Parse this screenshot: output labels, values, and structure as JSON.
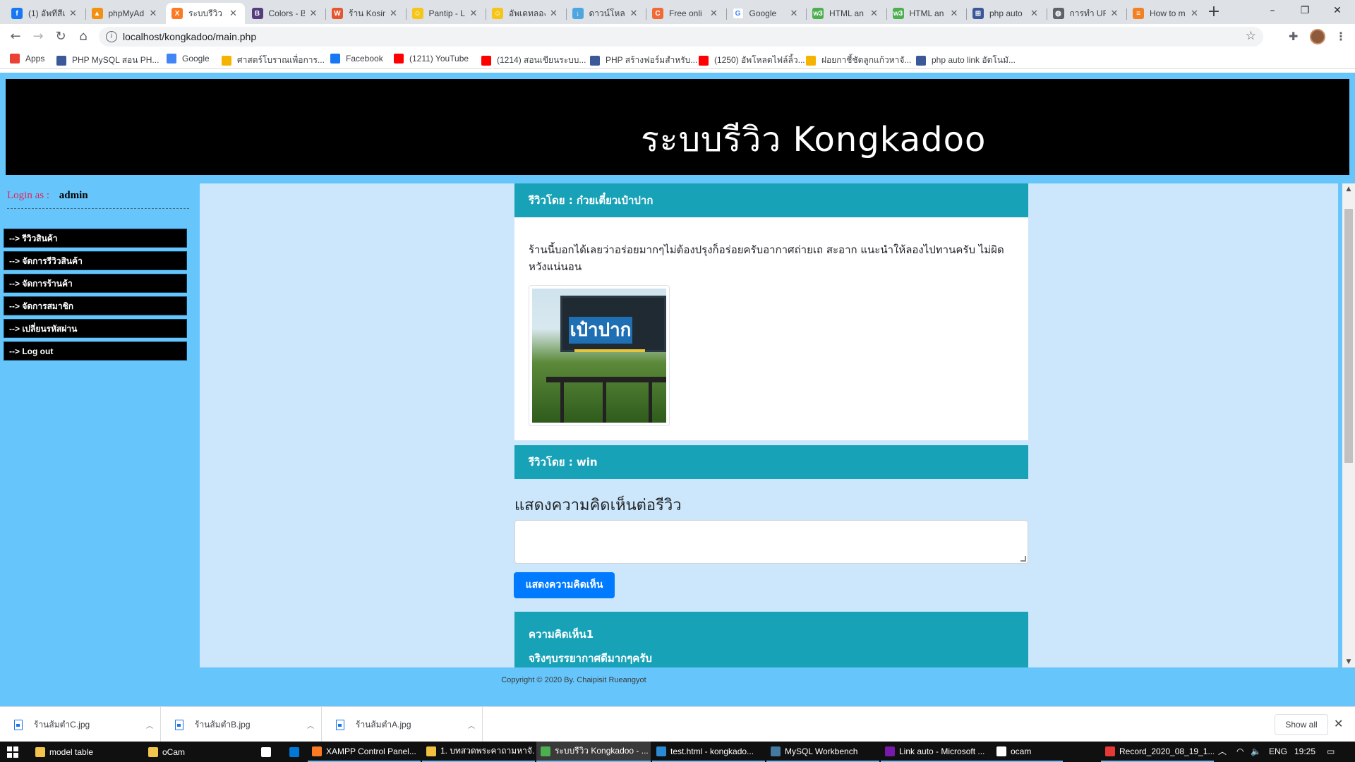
{
  "browser": {
    "tabs": [
      {
        "title": "(1) อัพทีสีเ",
        "icon": "facebook-icon",
        "color": "#1877f2",
        "glyph": "f"
      },
      {
        "title": "phpMyAd",
        "icon": "phpmyadmin-icon",
        "color": "#f29111",
        "glyph": "▲"
      },
      {
        "title": "ระบบรีวิว K",
        "icon": "xampp-icon",
        "color": "#fb7a24",
        "glyph": "X",
        "active": true
      },
      {
        "title": "Colors - B",
        "icon": "bootstrap-icon",
        "color": "#563d7c",
        "glyph": "B"
      },
      {
        "title": "ร้าน Kosin",
        "icon": "wongnai-icon",
        "color": "#e4572e",
        "glyph": "W"
      },
      {
        "title": "Pantip - L",
        "icon": "pantip-icon",
        "color": "#f5c518",
        "glyph": "☺"
      },
      {
        "title": "อัพเดทลอง",
        "icon": "pantip-icon",
        "color": "#f5c518",
        "glyph": "☺"
      },
      {
        "title": "ดาวน์โหลด",
        "icon": "download-icon",
        "color": "#4ea6e0",
        "glyph": "↓"
      },
      {
        "title": "Free onli",
        "icon": "free-online-icon",
        "color": "#f06a35",
        "glyph": "C"
      },
      {
        "title": "Google",
        "icon": "google-icon",
        "color": "#ffffff",
        "glyph": "G"
      },
      {
        "title": "HTML an",
        "icon": "w3schools-icon",
        "color": "#4caf50",
        "glyph": "w3"
      },
      {
        "title": "HTML an",
        "icon": "w3schools-icon",
        "color": "#4caf50",
        "glyph": "w3"
      },
      {
        "title": "php auto",
        "icon": "php-icon",
        "color": "#3b5998",
        "glyph": "⊞"
      },
      {
        "title": "การทำ URL",
        "icon": "globe-icon",
        "color": "#5f6368",
        "glyph": "◍"
      },
      {
        "title": "How to m",
        "icon": "stackoverflow-icon",
        "color": "#f48024",
        "glyph": "≡"
      }
    ],
    "url": "localhost/kongkadoo/main.php",
    "bookmarks": [
      {
        "label": "Apps",
        "icon": "apps-icon",
        "color": "#ea4335"
      },
      {
        "label": "PHP MySQL สอน PH...",
        "icon": "php-icon",
        "color": "#3b5998"
      },
      {
        "label": "Google",
        "icon": "google-icon",
        "color": "#4285f4"
      },
      {
        "label": "ศาสตร์โบราณเพื่อการ...",
        "icon": "rainbow-icon",
        "color": "#f4b400"
      },
      {
        "label": "Facebook",
        "icon": "facebook-icon",
        "color": "#1877f2"
      },
      {
        "label": "(1211) YouTube",
        "icon": "youtube-icon",
        "color": "#ff0000"
      },
      {
        "label": "(1214) สอนเขียนระบบ...",
        "icon": "youtube-icon",
        "color": "#ff0000"
      },
      {
        "label": "PHP สร้างฟอร์มสำหรับ...",
        "icon": "php-icon",
        "color": "#3b5998"
      },
      {
        "label": "(1250) อัพโหลดไฟล์ลิ้ว...",
        "icon": "youtube-icon",
        "color": "#ff0000"
      },
      {
        "label": "ฝอยกาชี้ชัดลูกแก้วหาจั...",
        "icon": "rainbow-icon",
        "color": "#f4b400"
      },
      {
        "label": "php auto link อัตโนมั...",
        "icon": "php-icon",
        "color": "#3b5998"
      }
    ]
  },
  "page": {
    "banner_title": "ระบบรีวิว Kongkadoo",
    "login_label": "Login as :",
    "login_user": "admin",
    "menu": [
      "--> รีวิวสินค้า",
      "--> จัดการรีวิวสินค้า",
      "--> จัดการร้านค้า",
      "--> จัดการสมาชิก",
      "--> เปลี่ยนรหัสผ่าน",
      "--> Log out"
    ],
    "review1_header": "รีวิวโดย : ก๋วยเตี๋ยวเป๋าปาก",
    "review1_text": "ร้านนี้บอกได้เลยว่าอร่อยมากๆไม่ต้องปรุงก็อร่อยครับอากาศถ่ายเถ สะอาก แนะนำให้ลองไปทานครับ ไม่ผิดหวังแน่นอน",
    "review1_photo_sign": "เป๋าปาก",
    "review2_header": "รีวิวโดย : win",
    "comment_title": "แสดงความคิดเห็นต่อรีวิว",
    "comment_placeholder": "",
    "comment_button": "แสดงความคิดเห็น",
    "comment1_title": "ความคิดเห็น1",
    "comment1_text": "จริงๆบรรยากาศดีมากๆครับ",
    "footer": "Copyright © 2020 By. Chaipisit Rueangyot"
  },
  "downloads": {
    "items": [
      "ร้านส้มตำC.jpg",
      "ร้านส้มตำB.jpg",
      "ร้านส้มตำA.jpg"
    ],
    "show_all": "Show all"
  },
  "taskbar": {
    "items": [
      {
        "label": "model table",
        "icon": "folder-icon",
        "color": "#f3c44b"
      },
      {
        "label": "oCam",
        "icon": "folder-icon",
        "color": "#f3c44b"
      },
      {
        "label": "",
        "icon": "store-icon",
        "color": "#ffffff"
      },
      {
        "label": "",
        "icon": "mail-icon",
        "color": "#0078d7"
      },
      {
        "label": "XAMPP Control Panel...",
        "icon": "xampp-icon",
        "color": "#fb7a24"
      },
      {
        "label": "1. บทสวดพระคาถามหาจั...",
        "icon": "winamp-icon",
        "color": "#f0c040"
      },
      {
        "label": "ระบบรีวิว Kongkadoo - ...",
        "icon": "chrome-icon",
        "color": "#4caf50"
      },
      {
        "label": "test.html - kongkado...",
        "icon": "vscode-icon",
        "color": "#2a8ad4"
      },
      {
        "label": "MySQL Workbench",
        "icon": "mysql-workbench-icon",
        "color": "#4479a1"
      },
      {
        "label": "Link auto - Microsoft ...",
        "icon": "onenote-icon",
        "color": "#7719aa"
      },
      {
        "label": "ocam",
        "icon": "ocam-icon",
        "color": "#ffffff"
      },
      {
        "label": "Record_2020_08_19_1...",
        "icon": "record-icon",
        "color": "#e53935"
      }
    ],
    "lang": "ENG",
    "time": "19:25"
  }
}
